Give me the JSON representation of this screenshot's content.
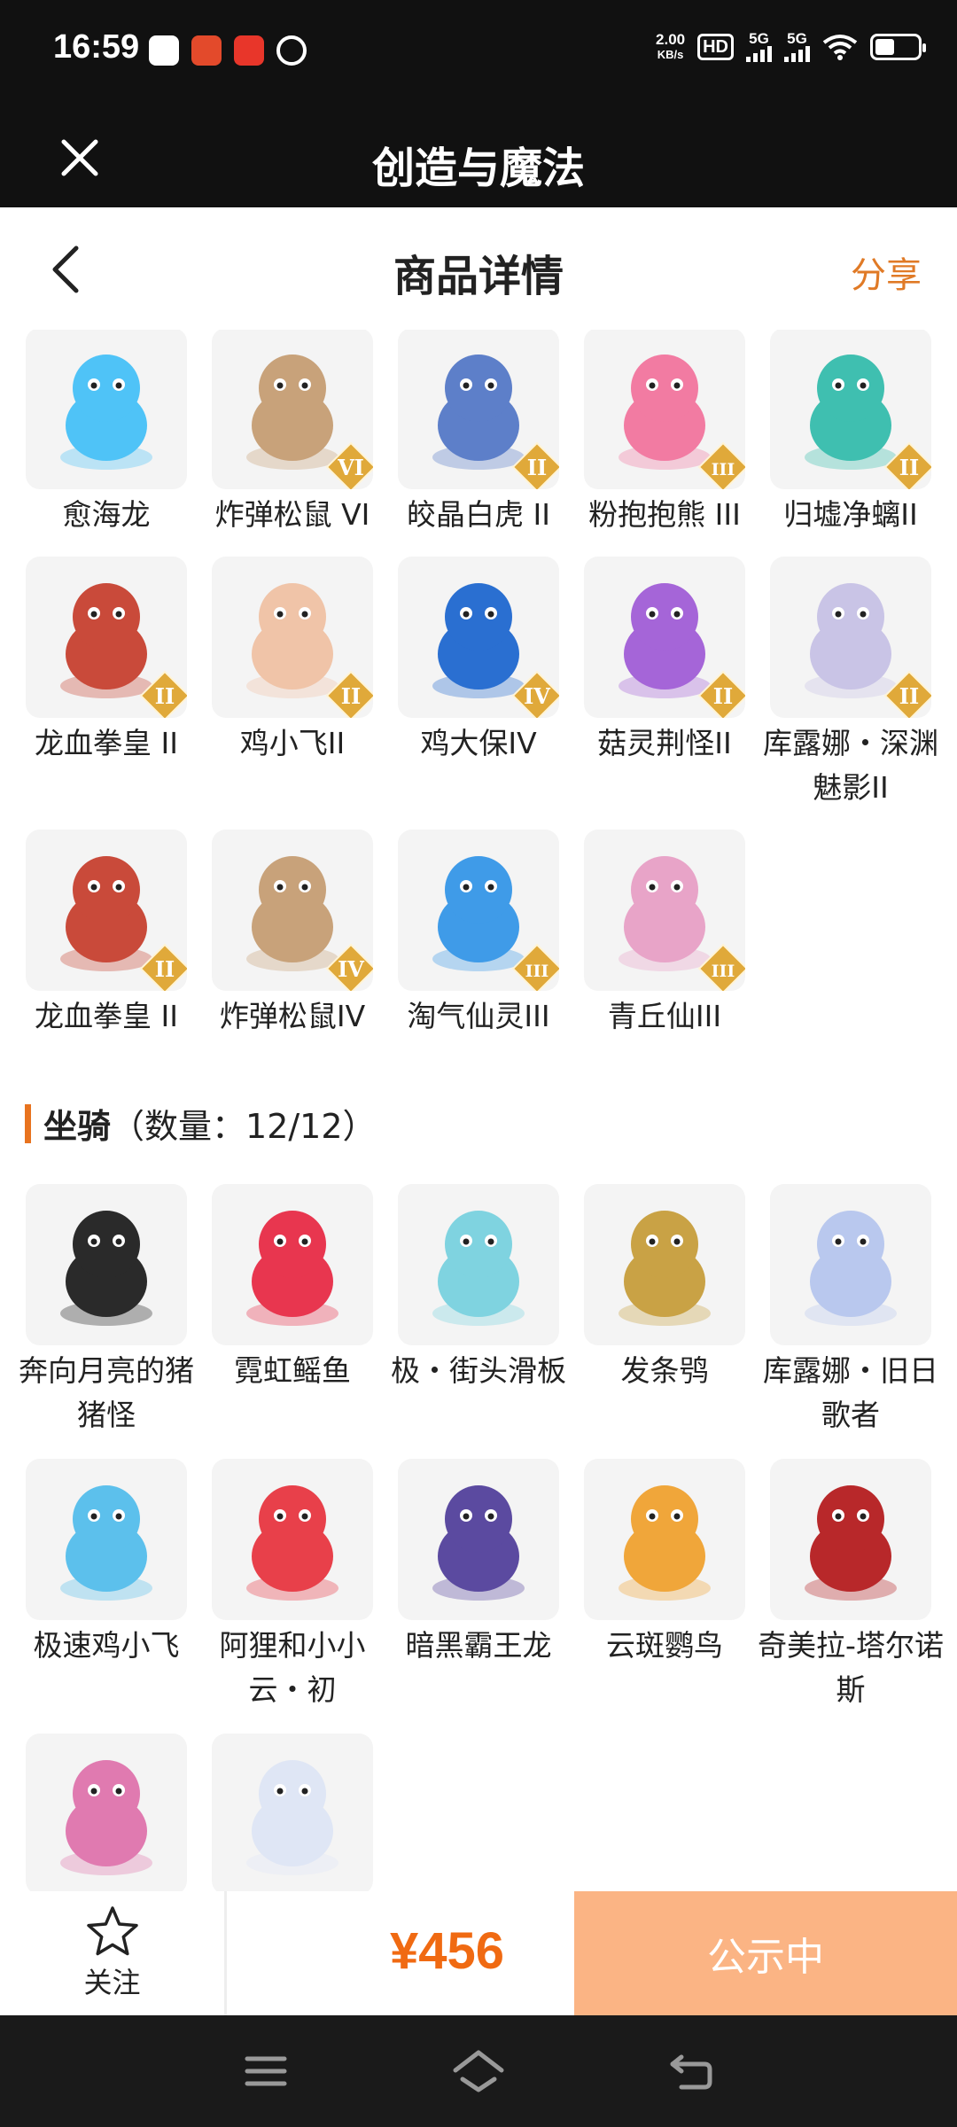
{
  "status_bar": {
    "time": "16:59",
    "net_speed_value": "2.00",
    "net_speed_unit": "KB/s",
    "hd_label": "HD",
    "signal1_label": "5G",
    "signal2_label": "5G",
    "battery_percent": 45
  },
  "title_bar": {
    "title": "创造与魔法"
  },
  "page_header": {
    "title": "商品详情",
    "share_label": "分享"
  },
  "pets": [
    {
      "name": "愈海龙",
      "rank": "",
      "icon": "sea-dragon-icon",
      "color": "#4fc3f7"
    },
    {
      "name": "炸弹松鼠 VI",
      "rank": "VI",
      "icon": "bomb-squirrel-icon",
      "color": "#c8a27a"
    },
    {
      "name": "皎晶白虎 II",
      "rank": "II",
      "icon": "white-tiger-icon",
      "color": "#5d7fc9"
    },
    {
      "name": "粉抱抱熊 III",
      "rank": "III",
      "icon": "pink-bear-icon",
      "color": "#f27ba2"
    },
    {
      "name": "归墟净螭II",
      "rank": "II",
      "icon": "jade-dragon-icon",
      "color": "#3fbfb0"
    },
    {
      "name": "龙血拳皇 II",
      "rank": "II",
      "icon": "dragon-blood-boxer-icon",
      "color": "#c94a3a"
    },
    {
      "name": "鸡小飞II",
      "rank": "II",
      "icon": "little-chick-icon",
      "color": "#f0c4a8"
    },
    {
      "name": "鸡大保IV",
      "rank": "IV",
      "icon": "big-chick-icon",
      "color": "#2a6fd1"
    },
    {
      "name": "菇灵荆怪II",
      "rank": "II",
      "icon": "mushroom-spirit-icon",
      "color": "#a565d8"
    },
    {
      "name": "库露娜・深渊魅影II",
      "rank": "II",
      "icon": "kuluna-abyss-icon",
      "color": "#c9c4e6"
    },
    {
      "name": "龙血拳皇 II",
      "rank": "II",
      "icon": "dragon-blood-boxer-icon",
      "color": "#c94a3a"
    },
    {
      "name": "炸弹松鼠IV",
      "rank": "IV",
      "icon": "bomb-squirrel-icon",
      "color": "#c8a27a"
    },
    {
      "name": "淘气仙灵III",
      "rank": "III",
      "icon": "naughty-spirit-icon",
      "color": "#3f9be8"
    },
    {
      "name": "青丘仙III",
      "rank": "III",
      "icon": "fox-fairy-icon",
      "color": "#e8a4c8"
    }
  ],
  "mounts_section": {
    "title": "坐骑",
    "count_text": "（数量：12/12）"
  },
  "mounts": [
    {
      "name": "奔向月亮的猪猪怪",
      "icon": "moon-pig-icon",
      "color": "#2a2a2a"
    },
    {
      "name": "霓虹鳐鱼",
      "icon": "neon-ray-icon",
      "color": "#e8364f"
    },
    {
      "name": "极・街头滑板",
      "icon": "skateboard-icon",
      "color": "#7fd3e0"
    },
    {
      "name": "发条鸮",
      "icon": "clockwork-owl-icon",
      "color": "#c9a245"
    },
    {
      "name": "库露娜・旧日歌者",
      "icon": "kuluna-singer-icon",
      "color": "#b9c8ee"
    },
    {
      "name": "极速鸡小飞",
      "icon": "fast-chick-icon",
      "color": "#5cc0ec"
    },
    {
      "name": "阿狸和小小云・初",
      "icon": "ali-cloud-icon",
      "color": "#e8404a"
    },
    {
      "name": "暗黑霸王龙",
      "icon": "dark-trex-icon",
      "color": "#5b4aa0"
    },
    {
      "name": "云斑鹦鸟",
      "icon": "cloud-parrot-icon",
      "color": "#f0a63a"
    },
    {
      "name": "奇美拉-塔尔诺斯",
      "icon": "chimera-icon",
      "color": "#b8282a"
    },
    {
      "name": "",
      "icon": "winged-beast-icon",
      "color": "#e07ab0"
    },
    {
      "name": "",
      "icon": "white-fox-icon",
      "color": "#dfe6f5"
    }
  ],
  "action_bar": {
    "follow_label": "关注",
    "price": "¥456",
    "button_label": "公示中"
  },
  "colors": {
    "accent": "#e8731f",
    "price": "#f06a12",
    "button": "#fbb484"
  }
}
